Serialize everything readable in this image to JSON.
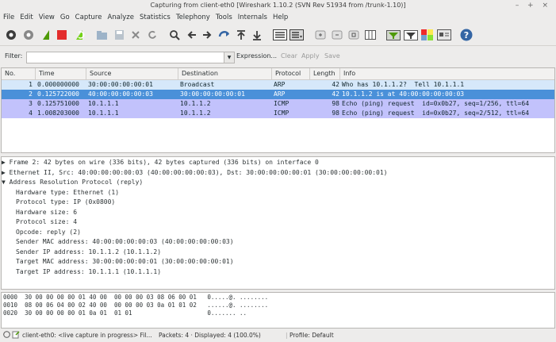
{
  "window": {
    "title": "Capturing from client-eth0   [Wireshark 1.10.2  (SVN Rev 51934 from /trunk-1.10)]",
    "controls": "– + ×"
  },
  "menu": [
    "File",
    "Edit",
    "View",
    "Go",
    "Capture",
    "Analyze",
    "Statistics",
    "Telephony",
    "Tools",
    "Internals",
    "Help"
  ],
  "toolbar_icons": [
    "interface-list-icon",
    "capture-options-icon",
    "start-capture-icon",
    "stop-capture-icon",
    "restart-capture-icon",
    "open-file-icon",
    "save-file-icon",
    "close-file-icon",
    "reload-icon",
    "find-packet-icon",
    "go-back-icon",
    "go-forward-icon",
    "go-to-packet-icon",
    "go-first-icon",
    "go-last-icon",
    "colorize-icon",
    "autoscroll-icon",
    "zoom-in-icon",
    "zoom-out-icon",
    "normal-size-icon",
    "resize-columns-icon",
    "capture-filters-icon",
    "display-filters-icon",
    "coloring-rules-icon",
    "preferences-icon",
    "help-icon"
  ],
  "filter": {
    "label": "Filter:",
    "value": "",
    "expression": "Expression...",
    "clear": "Clear",
    "apply": "Apply",
    "save": "Save"
  },
  "packet_list": {
    "headers": [
      "No.",
      "Time",
      "Source",
      "Destination",
      "Protocol",
      "Length",
      "Info"
    ],
    "rows": [
      {
        "no": "1",
        "time": "0.000000000",
        "source": "30:00:00:00:00:01",
        "destination": "Broadcast",
        "protocol": "ARP",
        "length": "42",
        "info": "Who has 10.1.1.2?  Tell 10.1.1.1",
        "bg": "#d6e8fa",
        "fg": "#12272e"
      },
      {
        "no": "2",
        "time": "0.125722000",
        "source": "40:00:00:00:00:03",
        "destination": "30:00:00:00:00:01",
        "protocol": "ARP",
        "length": "42",
        "info": "10.1.1.2 is at 40:00:00:00:00:03",
        "bg": "#4a90d9",
        "fg": "#ffffff"
      },
      {
        "no": "3",
        "time": "0.125751000",
        "source": "10.1.1.1",
        "destination": "10.1.1.2",
        "protocol": "ICMP",
        "length": "98",
        "info": "Echo (ping) request  id=0x0b27, seq=1/256, ttl=64",
        "bg": "#c2c2fc",
        "fg": "#12272e"
      },
      {
        "no": "4",
        "time": "1.008203000",
        "source": "10.1.1.1",
        "destination": "10.1.1.2",
        "protocol": "ICMP",
        "length": "98",
        "info": "Echo (ping) request  id=0x0b27, seq=2/512, ttl=64",
        "bg": "#c2c2fc",
        "fg": "#12272e"
      }
    ]
  },
  "details": [
    {
      "arrow": "▶",
      "indent": 0,
      "text": "Frame 2: 42 bytes on wire (336 bits), 42 bytes captured (336 bits) on interface 0"
    },
    {
      "arrow": "▶",
      "indent": 0,
      "text": "Ethernet II, Src: 40:00:00:00:00:03 (40:00:00:00:00:03), Dst: 30:00:00:00:00:01 (30:00:00:00:00:01)"
    },
    {
      "arrow": "▼",
      "indent": 0,
      "text": "Address Resolution Protocol (reply)"
    },
    {
      "arrow": "",
      "indent": 1,
      "text": "Hardware type: Ethernet (1)"
    },
    {
      "arrow": "",
      "indent": 1,
      "text": "Protocol type: IP (0x0800)"
    },
    {
      "arrow": "",
      "indent": 1,
      "text": "Hardware size: 6"
    },
    {
      "arrow": "",
      "indent": 1,
      "text": "Protocol size: 4"
    },
    {
      "arrow": "",
      "indent": 1,
      "text": "Opcode: reply (2)"
    },
    {
      "arrow": "",
      "indent": 1,
      "text": "Sender MAC address: 40:00:00:00:00:03 (40:00:00:00:00:03)"
    },
    {
      "arrow": "",
      "indent": 1,
      "text": "Sender IP address: 10.1.1.2 (10.1.1.2)"
    },
    {
      "arrow": "",
      "indent": 1,
      "text": "Target MAC address: 30:00:00:00:00:01 (30:00:00:00:00:01)"
    },
    {
      "arrow": "",
      "indent": 1,
      "text": "Target IP address: 10.1.1.1 (10.1.1.1)"
    }
  ],
  "bytes": [
    {
      "offset": "0000",
      "hex": "30 00 00 00 00 01 40 00  00 00 00 03 08 06 00 01",
      "ascii": "0.....@. ........"
    },
    {
      "offset": "0010",
      "hex": "08 00 06 04 00 02 40 00  00 00 00 03 0a 01 01 02",
      "ascii": "......@. ........"
    },
    {
      "offset": "0020",
      "hex": "30 00 00 00 00 01 0a 01  01 01",
      "ascii": "0....... .."
    }
  ],
  "status": {
    "capture": "client-eth0: <live capture in progress> Fil...",
    "packets": "Packets: 4 · Displayed: 4 (100.0%)",
    "profile": "Profile: Default"
  }
}
